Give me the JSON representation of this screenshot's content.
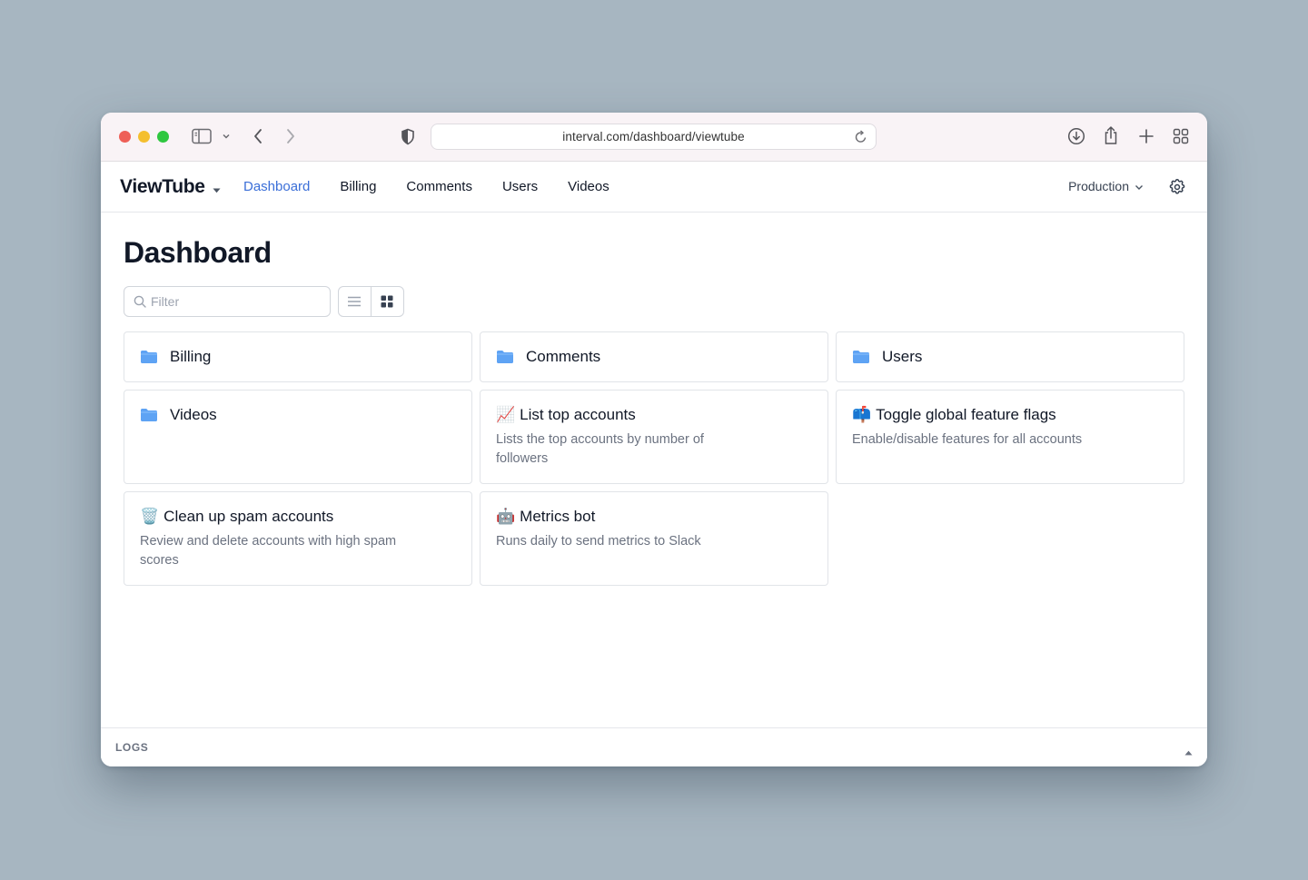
{
  "browser": {
    "url": "interval.com/dashboard/viewtube",
    "icons": [
      "sidebar-toggle-icon",
      "chevron-down-icon",
      "back-icon",
      "forward-icon",
      "shield-icon",
      "reload-icon",
      "download-icon",
      "share-icon",
      "new-tab-icon",
      "tab-overview-icon"
    ]
  },
  "app": {
    "brand": "ViewTube",
    "nav": [
      {
        "label": "Dashboard",
        "active": true
      },
      {
        "label": "Billing",
        "active": false
      },
      {
        "label": "Comments",
        "active": false
      },
      {
        "label": "Users",
        "active": false
      },
      {
        "label": "Videos",
        "active": false
      }
    ],
    "environment": "Production",
    "accent_color": "#3b6fd8"
  },
  "main": {
    "title": "Dashboard",
    "filter_placeholder": "Filter",
    "view_mode": "grid"
  },
  "cards": [
    {
      "kind": "folder",
      "title": "Billing"
    },
    {
      "kind": "folder",
      "title": "Comments"
    },
    {
      "kind": "folder",
      "title": "Users"
    },
    {
      "kind": "folder",
      "title": "Videos"
    },
    {
      "kind": "action",
      "emoji": "📈",
      "title": "List top accounts",
      "description": "Lists the top accounts by number of followers"
    },
    {
      "kind": "action",
      "emoji": "📫",
      "title": "Toggle global feature flags",
      "description": "Enable/disable features for all accounts"
    },
    {
      "kind": "action",
      "emoji": "🗑️",
      "title": "Clean up spam accounts",
      "description": "Review and delete accounts with high spam scores"
    },
    {
      "kind": "action",
      "emoji": "🤖",
      "title": "Metrics bot",
      "description": "Runs daily to send metrics to Slack"
    }
  ],
  "logs": {
    "label": "LOGS"
  }
}
